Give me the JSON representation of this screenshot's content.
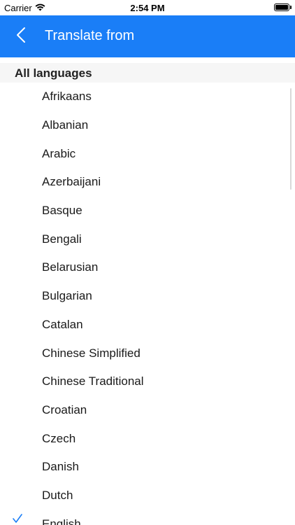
{
  "status_bar": {
    "carrier": "Carrier",
    "time": "2:54 PM",
    "icons": [
      "wifi-icon",
      "battery-icon"
    ]
  },
  "nav": {
    "title": "Translate from",
    "back_icon": "chevron-left-icon"
  },
  "section": {
    "header": "All languages"
  },
  "languages": [
    {
      "label": "Afrikaans",
      "selected": false
    },
    {
      "label": "Albanian",
      "selected": false
    },
    {
      "label": "Arabic",
      "selected": false
    },
    {
      "label": "Azerbaijani",
      "selected": false
    },
    {
      "label": "Basque",
      "selected": false
    },
    {
      "label": "Bengali",
      "selected": false
    },
    {
      "label": "Belarusian",
      "selected": false
    },
    {
      "label": "Bulgarian",
      "selected": false
    },
    {
      "label": "Catalan",
      "selected": false
    },
    {
      "label": "Chinese Simplified",
      "selected": false
    },
    {
      "label": "Chinese Traditional",
      "selected": false
    },
    {
      "label": "Croatian",
      "selected": false
    },
    {
      "label": "Czech",
      "selected": false
    },
    {
      "label": "Danish",
      "selected": false
    },
    {
      "label": "Dutch",
      "selected": false
    },
    {
      "label": "English",
      "selected": true
    }
  ],
  "colors": {
    "accent": "#1a7ef7",
    "section_bg": "#f6f6f6",
    "text": "#1a1a1a"
  }
}
